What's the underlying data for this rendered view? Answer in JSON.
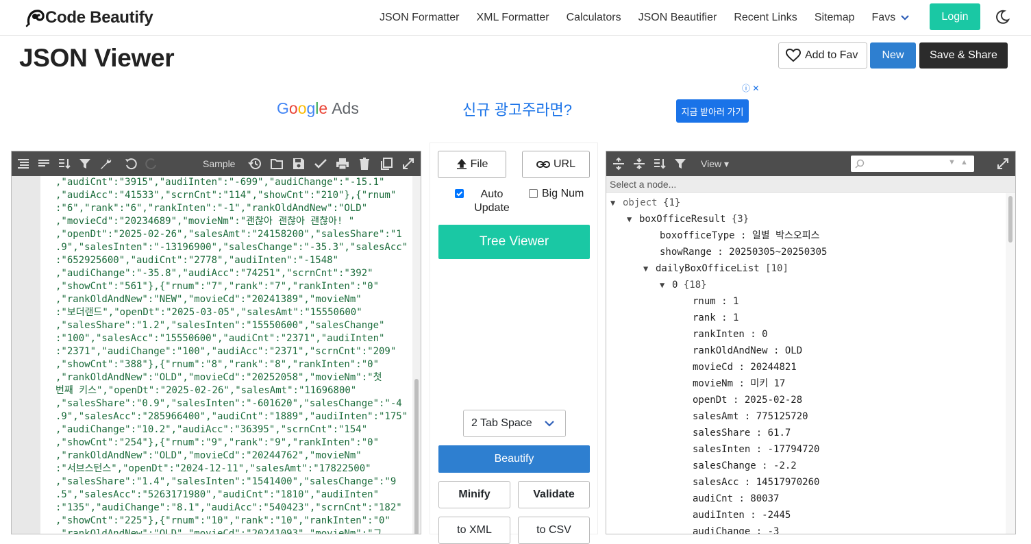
{
  "nav": {
    "logo_text": "Code Beautify",
    "links": [
      "JSON Formatter",
      "XML Formatter",
      "Calculators",
      "JSON Beautifier",
      "Recent Links",
      "Sitemap"
    ],
    "favs_label": "Favs",
    "login_label": "Login"
  },
  "page": {
    "title": "JSON Viewer",
    "add_fav_label": "Add to Fav",
    "new_label": "New",
    "save_share_label": "Save & Share"
  },
  "ad": {
    "brand_google": "Google",
    "brand_ads": "Ads",
    "headline": "신규 광고주라면?",
    "cta": "지금 받아러 가기"
  },
  "editor": {
    "sample_label": "Sample",
    "lines": [
      ",\"audiCnt\":\"3915\",\"audiInten\":\"-699\",\"audiChange\":\"-15.1\"",
      ",\"audiAcc\":\"41533\",\"scrnCnt\":\"114\",\"showCnt\":\"210\"},{\"rnum\"",
      ":\"6\",\"rank\":\"6\",\"rankInten\":\"-1\",\"rankOldAndNew\":\"OLD\"",
      ",\"movieCd\":\"20234689\",\"movieNm\":\"괜찮아 괜찮아 괜찮아! \"",
      ",\"openDt\":\"2025-02-26\",\"salesAmt\":\"24158200\",\"salesShare\":\"1",
      ".9\",\"salesInten\":\"-13196900\",\"salesChange\":\"-35.3\",\"salesAcc\"",
      ":\"652925600\",\"audiCnt\":\"2778\",\"audiInten\":\"-1548\"",
      ",\"audiChange\":\"-35.8\",\"audiAcc\":\"74251\",\"scrnCnt\":\"392\"",
      ",\"showCnt\":\"561\"},{\"rnum\":\"7\",\"rank\":\"7\",\"rankInten\":\"0\"",
      ",\"rankOldAndNew\":\"NEW\",\"movieCd\":\"20241389\",\"movieNm\"",
      ":\"보더랜드\",\"openDt\":\"2025-03-05\",\"salesAmt\":\"15550600\"",
      ",\"salesShare\":\"1.2\",\"salesInten\":\"15550600\",\"salesChange\"",
      ":\"100\",\"salesAcc\":\"15550600\",\"audiCnt\":\"2371\",\"audiInten\"",
      ":\"2371\",\"audiChange\":\"100\",\"audiAcc\":\"2371\",\"scrnCnt\":\"209\"",
      ",\"showCnt\":\"388\"},{\"rnum\":\"8\",\"rank\":\"8\",\"rankInten\":\"0\"",
      ",\"rankOldAndNew\":\"OLD\",\"movieCd\":\"20252058\",\"movieNm\":\"첫",
      "번째 키스\",\"openDt\":\"2025-02-26\",\"salesAmt\":\"11696800\"",
      ",\"salesShare\":\"0.9\",\"salesInten\":\"-601620\",\"salesChange\":\"-4",
      ".9\",\"salesAcc\":\"285966400\",\"audiCnt\":\"1889\",\"audiInten\":\"175\"",
      ",\"audiChange\":\"10.2\",\"audiAcc\":\"36395\",\"scrnCnt\":\"154\"",
      ",\"showCnt\":\"254\"},{\"rnum\":\"9\",\"rank\":\"9\",\"rankInten\":\"0\"",
      ",\"rankOldAndNew\":\"OLD\",\"movieCd\":\"20244762\",\"movieNm\"",
      ":\"서브스턴스\",\"openDt\":\"2024-12-11\",\"salesAmt\":\"17822500\"",
      ",\"salesShare\":\"1.4\",\"salesInten\":\"1541400\",\"salesChange\":\"9",
      ".5\",\"salesAcc\":\"5263171980\",\"audiCnt\":\"1810\",\"audiInten\"",
      ":\"135\",\"audiChange\":\"8.1\",\"audiAcc\":\"540423\",\"scrnCnt\":\"182\"",
      ",\"showCnt\":\"225\"},{\"rnum\":\"10\",\"rank\":\"10\",\"rankInten\":\"0\"",
      ",\"rankOldAndNew\":\"OLD\",\"movieCd\":\"20241093\",\"movieNm\":\"그"
    ]
  },
  "middle": {
    "file_label": "File",
    "url_label": "URL",
    "auto_update_label": "Auto Update",
    "auto_update_checked": true,
    "big_num_label": "Big Num",
    "big_num_checked": false,
    "tree_viewer_label": "Tree Viewer",
    "tab_space_value": "2 Tab Space",
    "beautify_label": "Beautify",
    "minify_label": "Minify",
    "validate_label": "Validate",
    "to_xml_label": "to XML",
    "to_csv_label": "to CSV"
  },
  "viewer": {
    "view_label": "View",
    "select_node_placeholder": "Select a node...",
    "tree": [
      {
        "depth": 0,
        "toggle": "▼",
        "key": "object",
        "meta": "{1}",
        "is_root": true
      },
      {
        "depth": 1,
        "toggle": "▼",
        "key": "boxOfficeResult",
        "meta": "{3}"
      },
      {
        "depth": 2,
        "toggle": "",
        "key": "boxofficeType",
        "value": "일별 박스오피스"
      },
      {
        "depth": 2,
        "toggle": "",
        "key": "showRange",
        "value": "20250305~20250305"
      },
      {
        "depth": 2,
        "toggle": "▼",
        "key": "dailyBoxOfficeList",
        "meta": "[10]"
      },
      {
        "depth": 3,
        "toggle": "▼",
        "key": "0",
        "meta": "{18}"
      },
      {
        "depth": 4,
        "toggle": "",
        "key": "rnum",
        "value": "1"
      },
      {
        "depth": 4,
        "toggle": "",
        "key": "rank",
        "value": "1"
      },
      {
        "depth": 4,
        "toggle": "",
        "key": "rankInten",
        "value": "0"
      },
      {
        "depth": 4,
        "toggle": "",
        "key": "rankOldAndNew",
        "value": "OLD"
      },
      {
        "depth": 4,
        "toggle": "",
        "key": "movieCd",
        "value": "20244821"
      },
      {
        "depth": 4,
        "toggle": "",
        "key": "movieNm",
        "value": "미키 17"
      },
      {
        "depth": 4,
        "toggle": "",
        "key": "openDt",
        "value": "2025-02-28"
      },
      {
        "depth": 4,
        "toggle": "",
        "key": "salesAmt",
        "value": "775125720"
      },
      {
        "depth": 4,
        "toggle": "",
        "key": "salesShare",
        "value": "61.7"
      },
      {
        "depth": 4,
        "toggle": "",
        "key": "salesInten",
        "value": "-17794720"
      },
      {
        "depth": 4,
        "toggle": "",
        "key": "salesChange",
        "value": "-2.2"
      },
      {
        "depth": 4,
        "toggle": "",
        "key": "salesAcc",
        "value": "14517970260"
      },
      {
        "depth": 4,
        "toggle": "",
        "key": "audiCnt",
        "value": "80037"
      },
      {
        "depth": 4,
        "toggle": "",
        "key": "audiInten",
        "value": "-2445"
      },
      {
        "depth": 4,
        "toggle": "",
        "key": "audiChange",
        "value": "-3"
      }
    ]
  },
  "colors": {
    "accent_green": "#1ac8a4",
    "accent_blue": "#2e7fd0",
    "toolbar_dark": "#4d4d4d",
    "json_string": "#1a6b3a"
  }
}
